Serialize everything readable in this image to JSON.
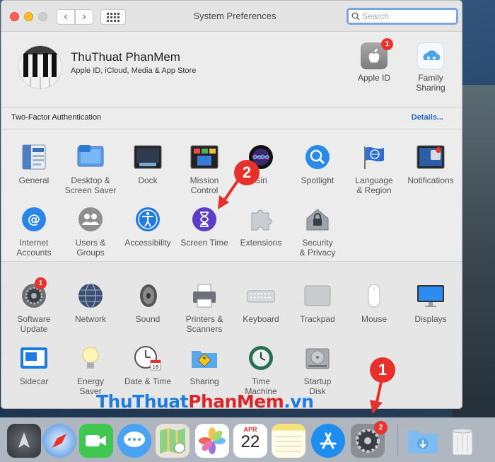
{
  "window": {
    "title": "System Preferences",
    "search_placeholder": "Search"
  },
  "account": {
    "name": "ThuThuat PhanMem",
    "subtitle": "Apple ID, iCloud, Media & App Store",
    "apple_id_label": "Apple ID",
    "apple_id_badge": "1",
    "family_label": "Family\nSharing"
  },
  "two_factor": {
    "label": "Two-Factor Authentication",
    "link": "Details..."
  },
  "panes_row1": [
    {
      "label": "General",
      "icon": "general-icon"
    },
    {
      "label": "Desktop &\nScreen Saver",
      "icon": "desktop-icon"
    },
    {
      "label": "Dock",
      "icon": "dock-icon"
    },
    {
      "label": "Mission\nControl",
      "icon": "mission-control-icon"
    },
    {
      "label": "Siri",
      "icon": "siri-icon"
    },
    {
      "label": "Spotlight",
      "icon": "spotlight-icon"
    },
    {
      "label": "Language\n& Region",
      "icon": "language-icon"
    },
    {
      "label": "Notifications",
      "icon": "notifications-icon"
    }
  ],
  "panes_row2": [
    {
      "label": "Internet\nAccounts",
      "icon": "internet-accounts-icon"
    },
    {
      "label": "Users &\nGroups",
      "icon": "users-icon"
    },
    {
      "label": "Accessibility",
      "icon": "accessibility-icon"
    },
    {
      "label": "Screen Time",
      "icon": "screen-time-icon"
    },
    {
      "label": "Extensions",
      "icon": "extensions-icon"
    },
    {
      "label": "Security\n& Privacy",
      "icon": "security-icon"
    }
  ],
  "panes_row3": [
    {
      "label": "Software\nUpdate",
      "icon": "software-update-icon",
      "badge": "1"
    },
    {
      "label": "Network",
      "icon": "network-icon"
    },
    {
      "label": "Sound",
      "icon": "sound-icon"
    },
    {
      "label": "Printers &\nScanners",
      "icon": "printer-icon"
    },
    {
      "label": "Keyboard",
      "icon": "keyboard-icon"
    },
    {
      "label": "Trackpad",
      "icon": "trackpad-icon"
    },
    {
      "label": "Mouse",
      "icon": "mouse-icon"
    },
    {
      "label": "Displays",
      "icon": "displays-icon"
    }
  ],
  "panes_row4": [
    {
      "label": "Sidecar",
      "icon": "sidecar-icon"
    },
    {
      "label": "Energy\nSaver",
      "icon": "energy-icon"
    },
    {
      "label": "Date & Time",
      "icon": "date-time-icon",
      "day": "18"
    },
    {
      "label": "Sharing",
      "icon": "sharing-icon"
    },
    {
      "label": "Time\nMachine",
      "icon": "time-machine-icon"
    },
    {
      "label": "Startup\nDisk",
      "icon": "startup-disk-icon"
    }
  ],
  "dock": {
    "calendar_month": "APR",
    "calendar_day": "22",
    "system_prefs_badge": "2",
    "icons": [
      "launchpad-icon",
      "safari-icon",
      "facetime-icon",
      "messages-icon",
      "maps-icon",
      "photos-icon",
      "calendar-icon",
      "notes-icon",
      "app-store-icon",
      "system-preferences-icon",
      "downloads-icon",
      "trash-icon"
    ]
  },
  "annotations": {
    "step1": "1",
    "step2": "2"
  },
  "watermark": {
    "part1": "ThuThuat",
    "part2": "PhanMem",
    "part3": ".vn"
  }
}
